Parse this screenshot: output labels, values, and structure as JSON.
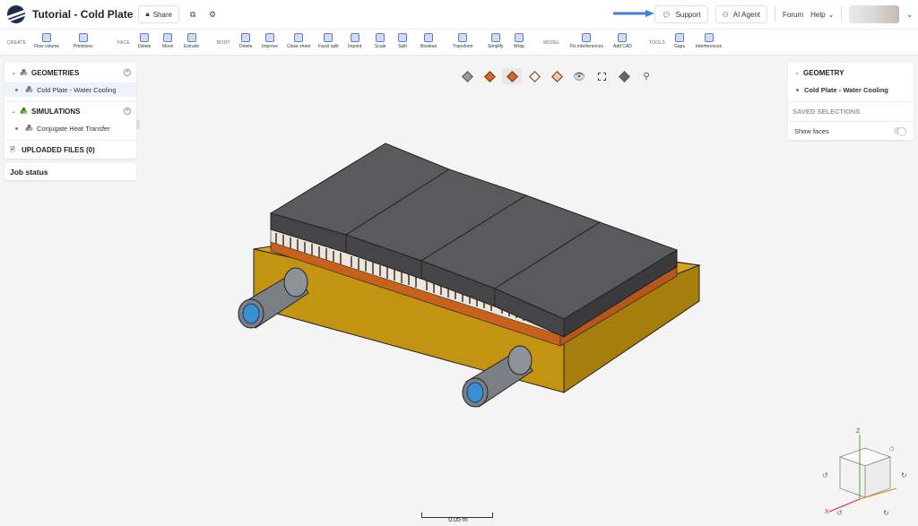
{
  "header": {
    "title": "Tutorial - Cold Plate",
    "share_label": "Share",
    "support_label": "Support",
    "ai_agent_label": "AI Agent",
    "forum_label": "Forum",
    "help_label": "Help"
  },
  "toolbar": {
    "groups": {
      "create": "CREATE",
      "face": "FACE",
      "body": "BODY",
      "model": "MODEL",
      "tools": "TOOLS"
    },
    "tools": [
      "Flow volume",
      "Primitives",
      "Delete",
      "Move",
      "Extrude",
      "Delete",
      "Improve",
      "Close sheet",
      "Facet split",
      "Imprint",
      "Scale",
      "Split",
      "Boolean",
      "Transform",
      "Simplify",
      "Wrap",
      "Fix interferences",
      "Add CAD",
      "Gaps",
      "Interferences"
    ]
  },
  "left_panel": {
    "geometries_label": "GEOMETRIES",
    "geometry_item": "Cold Plate - Water Cooling",
    "simulations_label": "SIMULATIONS",
    "simulation_item": "Conjugate Heat Transfer",
    "uploaded_files_label": "UPLOADED FILES (0)",
    "job_status_label": "Job status"
  },
  "right_panel": {
    "geometry_label": "GEOMETRY",
    "geometry_item": "Cold Plate - Water Cooling",
    "saved_selections_label": "SAVED SELECTIONS",
    "show_faces_label": "Show faces"
  },
  "viewport": {
    "scale_label": "0.05 m",
    "axis_x": "X",
    "axis_z": "Z"
  },
  "colors": {
    "base": "#d4a017",
    "chips": "#5a5a5c",
    "copper": "#d4701c",
    "pipe": "#7a7f85",
    "inlet": "#3a8fd0",
    "accent_arrow": "#3f7fd8"
  }
}
